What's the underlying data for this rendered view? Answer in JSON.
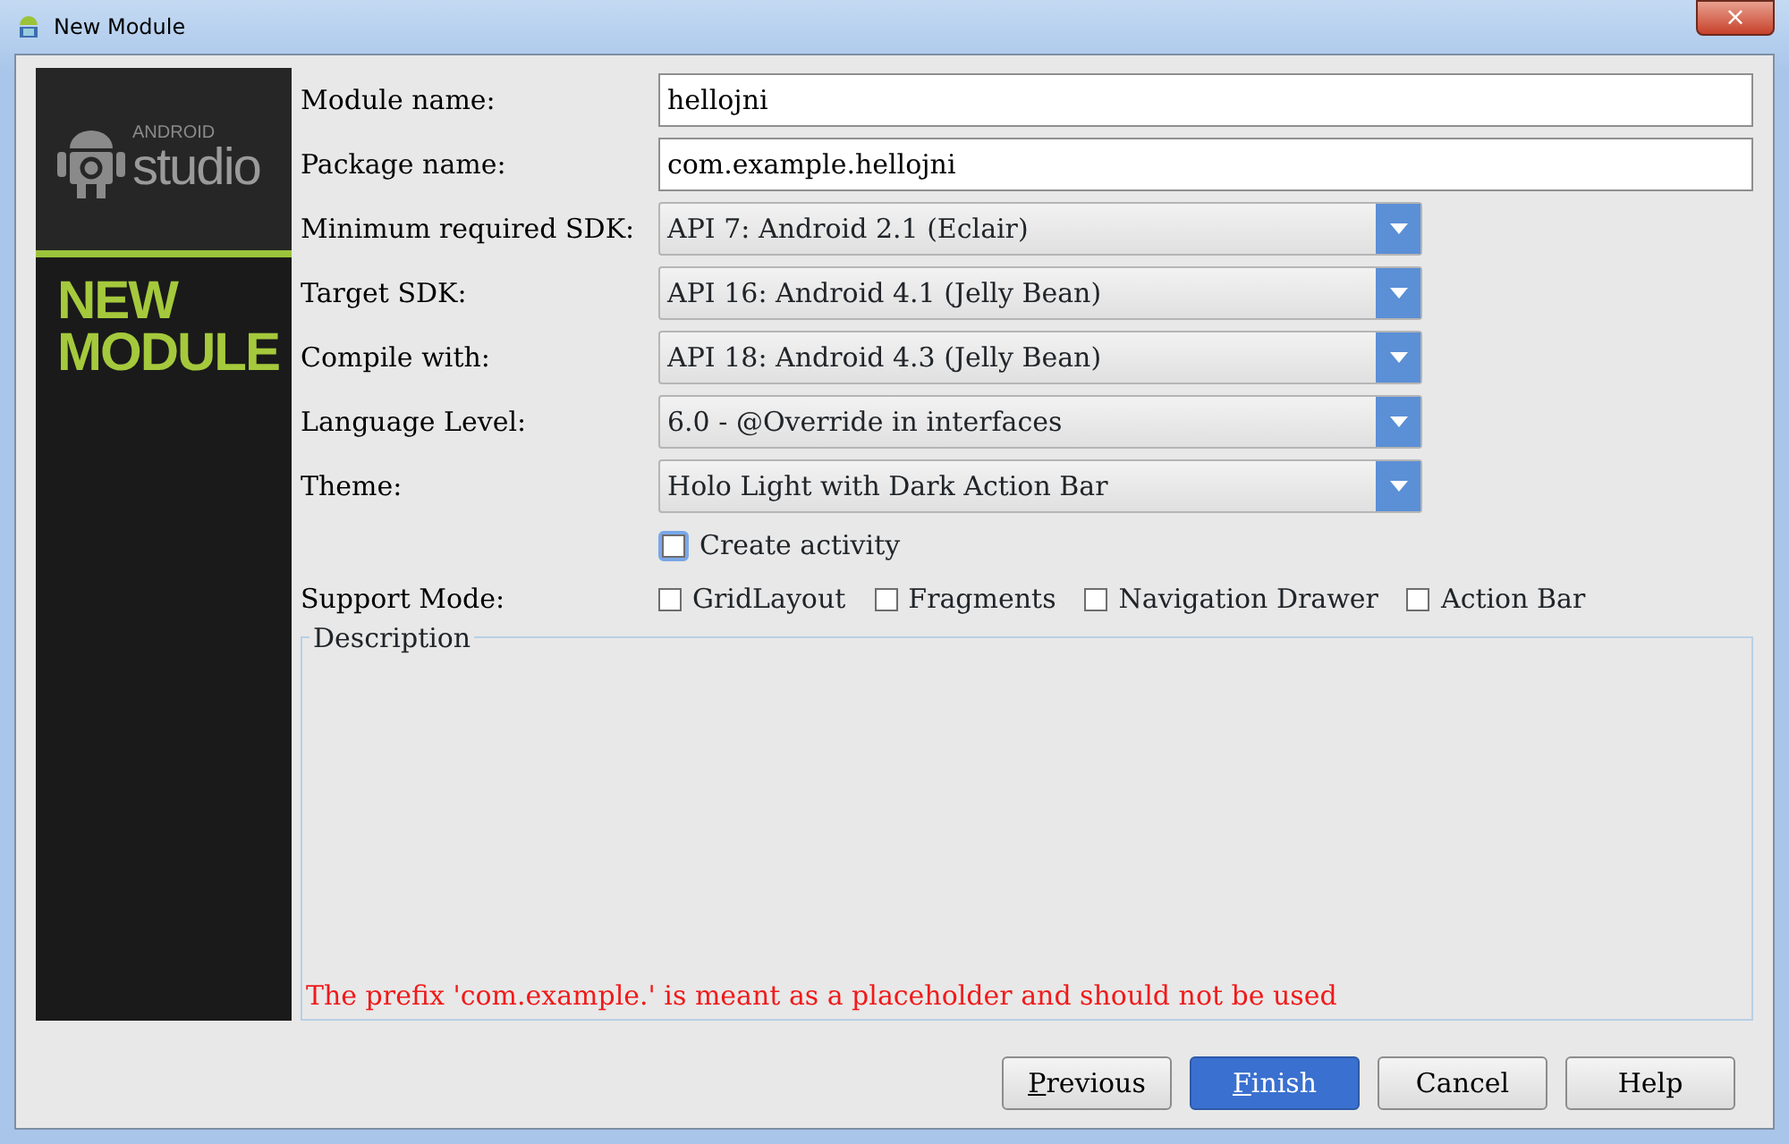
{
  "window": {
    "title": "New Module",
    "close_glyph": "×"
  },
  "banner": {
    "brand_small": "ANDROID",
    "brand": "studio",
    "heading": "NEW MODULE"
  },
  "fields": [
    {
      "kind": "text",
      "label": "Module name:",
      "value": "hellojni"
    },
    {
      "kind": "text",
      "label": "Package name:",
      "value": "com.example.hellojni"
    },
    {
      "kind": "dropdown",
      "label": "Minimum required SDK:",
      "value": "API 7: Android 2.1 (Eclair)"
    },
    {
      "kind": "dropdown",
      "label": "Target SDK:",
      "value": "API 16: Android 4.1 (Jelly Bean)"
    },
    {
      "kind": "dropdown",
      "label": "Compile with:",
      "value": "API 18: Android 4.3 (Jelly Bean)"
    },
    {
      "kind": "dropdown",
      "label": "Language Level:",
      "value": "6.0 - @Override in interfaces"
    },
    {
      "kind": "dropdown",
      "label": "Theme:",
      "value": "Holo Light with Dark Action Bar"
    }
  ],
  "create_activity": {
    "label": "Create activity",
    "checked": false,
    "focused": true
  },
  "support_mode": {
    "label": "Support Mode:",
    "options": [
      {
        "label": "GridLayout",
        "checked": false
      },
      {
        "label": "Fragments",
        "checked": false
      },
      {
        "label": "Navigation Drawer",
        "checked": false
      },
      {
        "label": "Action Bar",
        "checked": false
      }
    ]
  },
  "description": {
    "legend": "Description",
    "error": "The prefix 'com.example.' is meant as a placeholder and should not be used"
  },
  "buttons": [
    {
      "label": "Previous",
      "default": false,
      "mnemonic_first": true
    },
    {
      "label": "Finish",
      "default": true,
      "mnemonic_first": true
    },
    {
      "label": "Cancel",
      "default": false,
      "mnemonic_first": false
    },
    {
      "label": "Help",
      "default": false,
      "mnemonic_first": false
    }
  ]
}
